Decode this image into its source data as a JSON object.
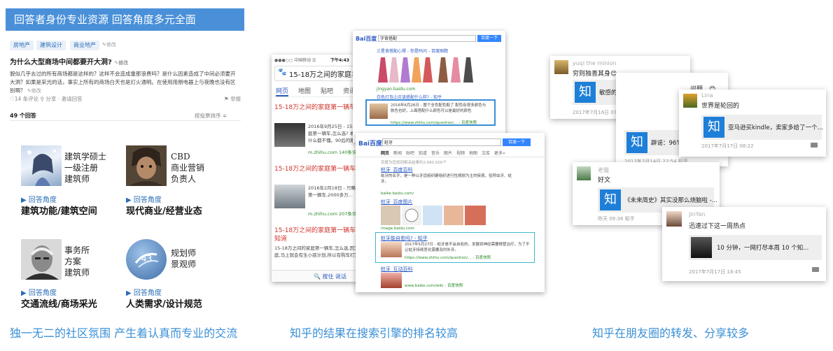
{
  "left": {
    "banner": "回答者身份专业资源  回答角度多元全面",
    "tags": [
      "房地产",
      "建筑设计",
      "商业地产"
    ],
    "tag_edit": "✎修改",
    "question_title": "为什么大型商场中间都要开大洞?",
    "question_edit": "✎修改",
    "question_body": "貌似几乎去过的所有商场都是这样的？这样不会造成重那浪费吗？是什么因素造成了中间必须要开大洞？如果是采光的话，事实上所有的商场白天也是灯火通明。在使用用朋电器上与夜晚也没有区别啊？",
    "question_body_edit": "✎修改",
    "meta": "♡14 条评论   ⚲ 分享 · 邀请回答",
    "report": "⚑ 举报",
    "answers_count": "49 个回答",
    "sort_by": "按投票排序 ≑",
    "experts": [
      {
        "roles": [
          "建筑学硕士",
          "一级注册",
          "建筑师"
        ],
        "link": "▶ 回答角度",
        "angle": "建筑功能/建筑空间"
      },
      {
        "roles": [
          "CBD",
          "商业营销",
          "负责人"
        ],
        "link": "▶ 回答角度",
        "angle": "现代商业/经营业态"
      },
      {
        "roles": [
          "事务所",
          "方案",
          "建筑师"
        ],
        "link": "▶ 回答角度",
        "angle": "交通流线/商场采光"
      },
      {
        "roles": [
          "规划师",
          "景观师"
        ],
        "link": "▶ 回答角度",
        "angle": "人类需求/设计规范"
      }
    ],
    "caption": "独一无二的社区氛围 产生着认真而专业的交流"
  },
  "middle": {
    "phone": {
      "status_carrier": "●●●○○ 中国移动 ☰",
      "status_time": "下午4:43",
      "search_text": "15-18万之间的家庭车",
      "tabs": [
        "网页",
        "地图",
        "贴吧",
        "资讯",
        "视"
      ],
      "results": [
        {
          "title": "15-18万之间的家庭第一辆车,怎么选?",
          "date": "2016年9月25日 -",
          "snippet": "15-18万之间的家庭第一辆车,怎么选? 本人汽车小白一个 什么都不懂。90后的刚概小夫妻...",
          "url": "m.zhihu.com  140条评价"
        },
        {
          "title": "15-18万之间的家庭第一辆车,怎么选?",
          "date": "2016年2月18日 -",
          "snippet": "只略少于我的家庭第一辆车,2000多万...",
          "url": "m.zhihu.com  207条评价"
        },
        {
          "title": "15-18万之间的家庭第一辆车,怎么选? 知道",
          "snippet": "15-18万之间的家庭第一辆车,怎么选,因为已经被嫁家庭,马上就会有生小孩计划,所以有购车打算...",
          "url": ""
        }
      ],
      "bottom": "🔍 按住 说话"
    },
    "baidu_top": {
      "logo": "Bai百度",
      "search": "字背搭配",
      "button": "百度一下",
      "item_title": "三星背搭配心得 - 你是吗问 - 百度图题",
      "img_source": "jingyan.baidu.com",
      "zhihu_link": "白色灯泡上应该搭配什么样? - 知乎",
      "zhihu_snippet": "2016年6月26日 - 整个全色配色鞋了 配色有很多颜色与肤色也好，上面搭配什么颜色可以是最好的颜色",
      "zhihu_url": "https://www.zhihu.com/question/... - 百度快照"
    },
    "baidu_bottom": {
      "logo": "Bai百度",
      "search": "蛀牙",
      "button": "百度一下",
      "tabs": [
        "网页",
        "新闻",
        "贴吧",
        "知道",
        "音乐",
        "图片",
        "视频",
        "地图",
        "文库",
        "更多»"
      ],
      "count": "百度为您找到相关结果约2,660,000个",
      "result1_title": "蛀牙_百度百科",
      "result1_snippet": "蛀牙的名字，是一种以牙齿组织硬组织进行性病损为主的疾病，俗称虫牙、蛀牙。",
      "result1_url": "baike.baidu.com/",
      "result2_title": "蛀牙_百度图片",
      "result2_url": "image.baidu.com",
      "zhihu_title": "蛀牙能自愈吗? - 知乎",
      "zhihu_snippet": "2017年5月27日 - 蛀牙是不会自愈的，发展到神经需要根管治疗，为了不让蛀牙持续恶化需要及时补牙。",
      "zhihu_url": "https://www.zhihu.com/question/... - 百度快照",
      "result4_title": "蛀牙_互动百科",
      "result4_url": "www.baike.com/wiki - 百度快照",
      "caption": ""
    },
    "caption": "知乎的结果在搜索引擎的排名较高"
  },
  "right": {
    "cards": [
      {
        "user": "yuqi the minion",
        "line": "穷则独善其身😊",
        "share": "敏感的人如何提高「钝感力」?",
        "date": "2017年7月16日 07:29"
      },
      {
        "user": "",
        "line": "问题…😊",
        "share": "辟谣：96%",
        "date": "2017年7月14日 22:54  知乎"
      },
      {
        "user": "Lina",
        "line": "世界是轮回的",
        "share": "亚马逊买kindle，卖家多给了一个...",
        "date": "2017年7月17日 08:22"
      },
      {
        "user": "老猫",
        "line": "好文",
        "share": "《未来简史》其实没那么烧脑啦 -...",
        "date": "昨天 09:36  知乎"
      },
      {
        "user": "JinYan",
        "line": "迅速过下这一周热点",
        "share": "10 分钟，一网打尽本周 10 个知...",
        "date": "2017年7月17日 18:45"
      }
    ],
    "zhi_char": "知",
    "caption": "知乎在朋友圈的转发、分享较多"
  }
}
